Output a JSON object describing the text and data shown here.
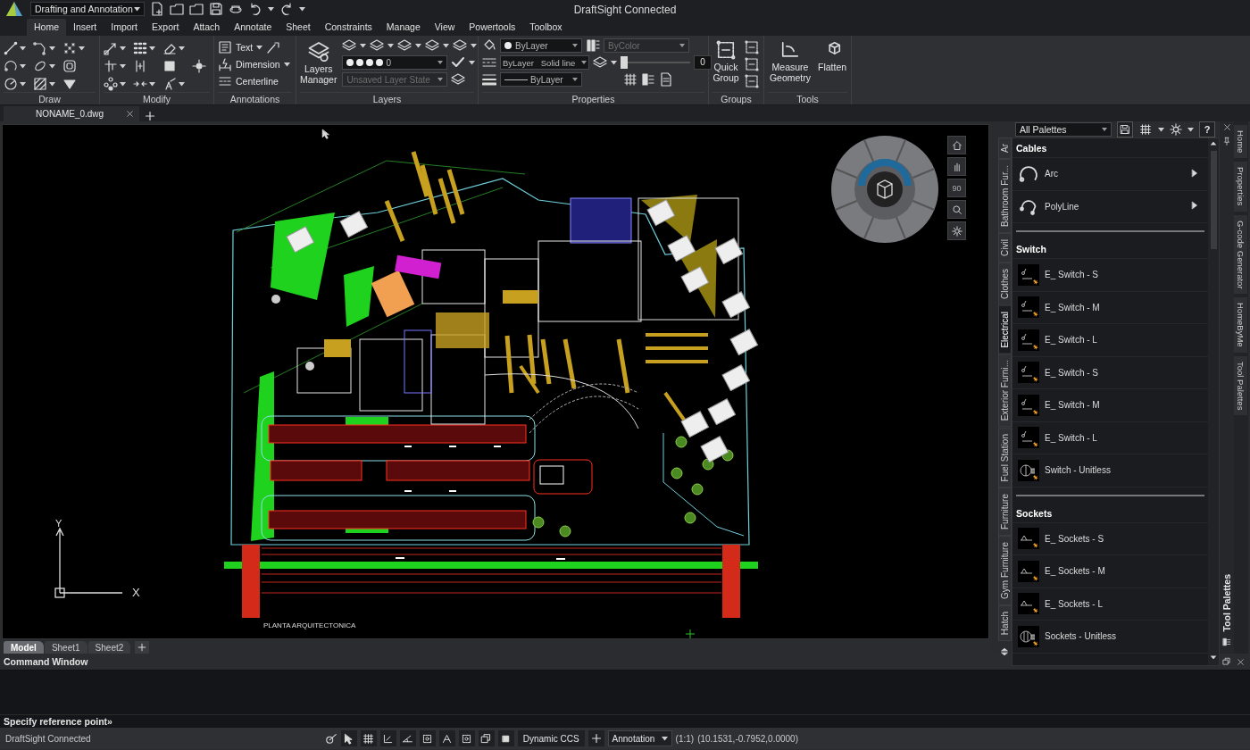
{
  "title_bar": {
    "workspace": "Drafting and Annotation",
    "title": "DraftSight Connected"
  },
  "menu_tabs": [
    {
      "label": "Home",
      "selected": true
    },
    {
      "label": "Insert",
      "selected": false
    },
    {
      "label": "Import",
      "selected": false
    },
    {
      "label": "Export",
      "selected": false
    },
    {
      "label": "Attach",
      "selected": false
    },
    {
      "label": "Annotate",
      "selected": false
    },
    {
      "label": "Sheet",
      "selected": false
    },
    {
      "label": "Constraints",
      "selected": false
    },
    {
      "label": "Manage",
      "selected": false
    },
    {
      "label": "View",
      "selected": false
    },
    {
      "label": "Powertools",
      "selected": false
    },
    {
      "label": "Toolbox",
      "selected": false
    }
  ],
  "ribbon": {
    "draw": {
      "label": "Draw"
    },
    "modify": {
      "label": "Modify"
    },
    "annotations": {
      "label": "Annotations",
      "tools": [
        "Text",
        "Dimension",
        "Centerline"
      ]
    },
    "layers": {
      "label": "Layers",
      "manager": "Layers Manager",
      "current_layer": "0",
      "layer_state": "Unsaved Layer State",
      "layer_state_disabled": true
    },
    "properties": {
      "label": "Properties",
      "color_setting": "ByLayer",
      "linestyle": "ByLayer",
      "linestyle_name": "Solid line",
      "lineweight": "ByLayer",
      "plot_style": "ByColor",
      "plot_style_disabled": true,
      "transparency": "0",
      "level": 0
    },
    "groups": {
      "label": "Groups",
      "quick_group": "Quick Group"
    },
    "tools": {
      "label": "Tools",
      "measure": "Measure Geometry",
      "flatten": "Flatten"
    }
  },
  "document_tabs": [
    {
      "label": "NONAME_0.dwg",
      "selected": true
    }
  ],
  "canvas": {
    "view_angle": "90",
    "axis_x": "X",
    "axis_y": "Y",
    "drawing_caption": "PLANTA ARQUITECTONICA"
  },
  "sheet_tabs": [
    {
      "label": "Model",
      "selected": true
    },
    {
      "label": "Sheet1",
      "selected": false
    },
    {
      "label": "Sheet2",
      "selected": false
    }
  ],
  "palette": {
    "title": "Tool Palettes",
    "selector": "All Palettes",
    "help": "?",
    "side_tabs": [
      {
        "label": "Ar",
        "selected": false
      },
      {
        "label": "Bathroom Fur...",
        "selected": false
      },
      {
        "label": "Civil",
        "selected": false
      },
      {
        "label": "Clothes",
        "selected": false
      },
      {
        "label": "Electrical",
        "selected": true
      },
      {
        "label": "Exterior Furni...",
        "selected": false
      },
      {
        "label": "Fuel Station",
        "selected": false
      },
      {
        "label": "Furniture",
        "selected": false
      },
      {
        "label": "Gym Furniture",
        "selected": false
      },
      {
        "label": "Hatch",
        "selected": false
      }
    ],
    "sections": [
      {
        "title": "Cables",
        "items": [
          {
            "label": "Arc",
            "kind": "arc",
            "flyout": true
          },
          {
            "label": "PolyLine",
            "kind": "polyline",
            "flyout": true
          }
        ]
      },
      {
        "title": "Switch",
        "items": [
          {
            "label": "E_ Switch - S",
            "kind": "switch",
            "flyout": false
          },
          {
            "label": "E_ Switch - M",
            "kind": "switch",
            "flyout": false
          },
          {
            "label": "E_ Switch - L",
            "kind": "switch",
            "flyout": false
          },
          {
            "label": "E_ Switch - S",
            "kind": "switch",
            "flyout": false
          },
          {
            "label": "E_ Switch - M",
            "kind": "switch",
            "flyout": false
          },
          {
            "label": "E_ Switch - L",
            "kind": "switch",
            "flyout": false
          },
          {
            "label": "Switch - Unitless",
            "kind": "switch_unitless",
            "flyout": false
          }
        ]
      },
      {
        "title": "Sockets",
        "items": [
          {
            "label": "E_ Sockets - S",
            "kind": "socket",
            "flyout": false
          },
          {
            "label": "E_ Sockets - M",
            "kind": "socket",
            "flyout": false
          },
          {
            "label": "E_ Sockets - L",
            "kind": "socket",
            "flyout": false
          },
          {
            "label": "Sockets - Unitless",
            "kind": "socket_unitless",
            "flyout": false
          }
        ]
      }
    ]
  },
  "dock_tabs": [
    {
      "label": "Home"
    },
    {
      "label": "Properties"
    },
    {
      "label": "G-code Generator"
    },
    {
      "label": "HomeByMe"
    },
    {
      "label": "Tool Palettes"
    }
  ],
  "command_window": {
    "title": "Command Window",
    "prompt": "Specify reference point»"
  },
  "status_bar": {
    "app": "DraftSight Connected",
    "ccs": "Dynamic CCS",
    "annotation_scale": "Annotation",
    "scale": "(1:1)",
    "coordinates": "(10.1531,-0.7952,0.0000)"
  }
}
